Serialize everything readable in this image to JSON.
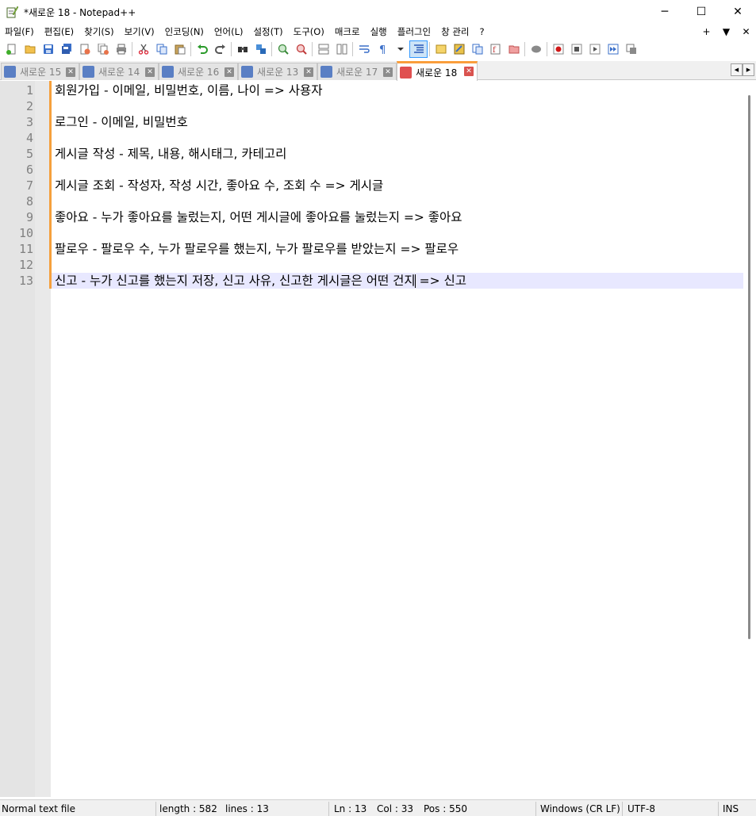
{
  "window": {
    "title": "*새로운 18 - Notepad++",
    "minimize": "─",
    "maximize": "☐",
    "close": "✕"
  },
  "menu": {
    "items": [
      "파일(F)",
      "편집(E)",
      "찾기(S)",
      "보기(V)",
      "인코딩(N)",
      "언어(L)",
      "설정(T)",
      "도구(O)",
      "매크로",
      "실행",
      "플러그인",
      "창 관리",
      "?"
    ],
    "right": [
      "+",
      "▼",
      "✕"
    ]
  },
  "toolbar": {
    "icons": [
      "new-file-icon",
      "open-file-icon",
      "save-icon",
      "save-all-icon",
      "close-icon",
      "close-all-icon",
      "print-icon",
      "cut-icon",
      "copy-icon",
      "paste-icon",
      "undo-icon",
      "redo-icon",
      "find-icon",
      "replace-icon",
      "zoom-in-icon",
      "zoom-out-icon",
      "sync-vertical-icon",
      "sync-horizontal-icon",
      "word-wrap-icon",
      "show-all-chars-icon",
      "indent-guide-icon",
      "user-lang-icon",
      "doc-map-icon",
      "doc-list-icon",
      "function-list-icon",
      "folder-workspace-icon",
      "monitor-icon",
      "record-macro-icon",
      "stop-macro-icon",
      "play-macro-icon",
      "run-macro-multiple-icon",
      "save-macro-icon"
    ]
  },
  "tabs": [
    {
      "label": "새로운 15",
      "active": false
    },
    {
      "label": "새로운 14",
      "active": false
    },
    {
      "label": "새로운 16",
      "active": false
    },
    {
      "label": "새로운 13",
      "active": false
    },
    {
      "label": "새로운 17",
      "active": false
    },
    {
      "label": "새로운 18",
      "active": true
    }
  ],
  "tab_close": "✕",
  "tab_scroll": {
    "left": "◀",
    "right": "▶"
  },
  "editor": {
    "lines": [
      {
        "num": "1",
        "text": "회원가입 - 이메일, 비밀번호, 이름, 나이 => 사용자"
      },
      {
        "num": "2",
        "text": ""
      },
      {
        "num": "3",
        "text": "로그인 - 이메일, 비밀번호"
      },
      {
        "num": "4",
        "text": ""
      },
      {
        "num": "5",
        "text": "게시글 작성 - 제목, 내용, 해시태그, 카테고리"
      },
      {
        "num": "6",
        "text": ""
      },
      {
        "num": "7",
        "text": "게시글 조회 - 작성자, 작성 시간, 좋아요 수, 조회 수 => 게시글"
      },
      {
        "num": "8",
        "text": ""
      },
      {
        "num": "9",
        "text": "좋아요 - 누가 좋아요를 눌렀는지, 어떤 게시글에 좋아요를 눌렀는지 => 좋아요"
      },
      {
        "num": "10",
        "text": ""
      },
      {
        "num": "11",
        "text": "팔로우 - 팔로우 수, 누가 팔로우를 했는지, 누가 팔로우를 받았는지 => 팔로우"
      },
      {
        "num": "12",
        "text": ""
      },
      {
        "num": "13",
        "text": "신고 - 누가 신고를 했는지 저장, 신고 사유, 신고한 게시글은 어떤 건지 => 신고"
      }
    ],
    "current_line": 13
  },
  "status": {
    "file_type": "Normal text file",
    "length": "length : 582",
    "lines": "lines : 13",
    "ln": "Ln : 13",
    "col": "Col : 33",
    "pos": "Pos : 550",
    "eol": "Windows (CR LF)",
    "encoding": "UTF-8",
    "mode": "INS"
  },
  "colors": {
    "tab_active_accent": "#fa9e3c",
    "current_line_bg": "#e8e8ff",
    "change_bar": "#f5a03c",
    "line_number": "#808080"
  }
}
